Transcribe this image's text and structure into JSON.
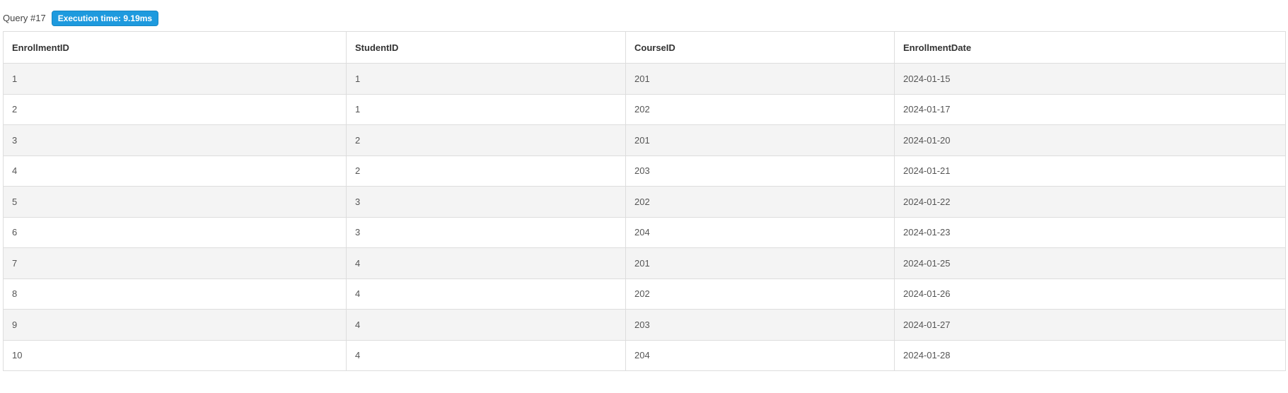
{
  "query": {
    "label": "Query #17",
    "execution_time": "Execution time: 9.19ms"
  },
  "table": {
    "columns": [
      "EnrollmentID",
      "StudentID",
      "CourseID",
      "EnrollmentDate"
    ],
    "rows": [
      [
        "1",
        "1",
        "201",
        "2024-01-15"
      ],
      [
        "2",
        "1",
        "202",
        "2024-01-17"
      ],
      [
        "3",
        "2",
        "201",
        "2024-01-20"
      ],
      [
        "4",
        "2",
        "203",
        "2024-01-21"
      ],
      [
        "5",
        "3",
        "202",
        "2024-01-22"
      ],
      [
        "6",
        "3",
        "204",
        "2024-01-23"
      ],
      [
        "7",
        "4",
        "201",
        "2024-01-25"
      ],
      [
        "8",
        "4",
        "202",
        "2024-01-26"
      ],
      [
        "9",
        "4",
        "203",
        "2024-01-27"
      ],
      [
        "10",
        "4",
        "204",
        "2024-01-28"
      ]
    ]
  },
  "colors": {
    "badge": "#1e9ade",
    "row_stripe": "#f4f4f4",
    "border": "#dddddd"
  }
}
